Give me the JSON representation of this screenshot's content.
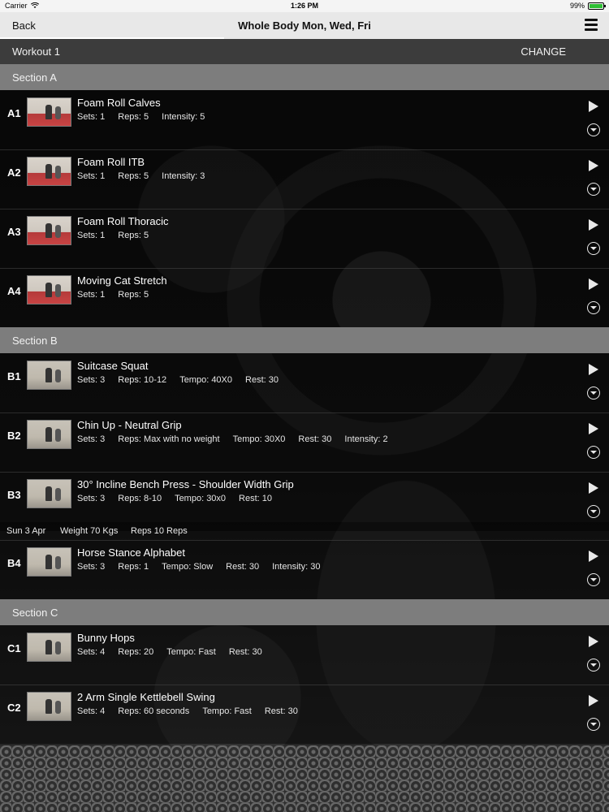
{
  "status_bar": {
    "carrier": "Carrier",
    "time": "1:26 PM",
    "battery": "99%",
    "battery_color": "#2fbf35"
  },
  "nav": {
    "back_label": "Back",
    "title": "Whole Body Mon, Wed, Fri",
    "menu_icon": "hamburger-menu-icon"
  },
  "workout": {
    "label": "Workout 1",
    "change_label": "CHANGE"
  },
  "sections": [
    {
      "title": "Section A",
      "exercises": [
        {
          "code": "A1",
          "name": "Foam Roll Calves",
          "stats": [
            "Sets: 1",
            "Reps: 5",
            "Intensity: 5"
          ]
        },
        {
          "code": "A2",
          "name": "Foam Roll ITB",
          "stats": [
            "Sets: 1",
            "Reps: 5",
            "Intensity: 3"
          ]
        },
        {
          "code": "A3",
          "name": "Foam Roll Thoracic",
          "stats": [
            "Sets: 1",
            "Reps: 5"
          ]
        },
        {
          "code": "A4",
          "name": "Moving Cat Stretch",
          "stats": [
            "Sets: 1",
            "Reps: 5"
          ]
        }
      ]
    },
    {
      "title": "Section B",
      "exercises": [
        {
          "code": "B1",
          "name": "Suitcase Squat",
          "stats": [
            "Sets: 3",
            "Reps: 10-12",
            "Tempo: 40X0",
            "Rest: 30"
          ]
        },
        {
          "code": "B2",
          "name": "Chin Up - Neutral Grip",
          "stats": [
            "Sets: 3",
            "Reps: Max with no weight",
            "Tempo: 30X0",
            "Rest: 30",
            "Intensity: 2"
          ]
        },
        {
          "code": "B3",
          "name": "30° Incline Bench Press - Shoulder Width Grip",
          "stats": [
            "Sets: 3",
            "Reps: 8-10",
            "Tempo: 30x0",
            "Rest: 10"
          ]
        },
        {
          "code": "B4",
          "name": "Horse Stance Alphabet",
          "stats": [
            "Sets: 3",
            "Reps: 1",
            "Tempo: Slow",
            "Rest: 30",
            "Intensity: 30"
          ]
        }
      ],
      "history": {
        "date": "Sun 3 Apr",
        "weight": "Weight 70 Kgs",
        "reps": "Reps 10 Reps"
      }
    },
    {
      "title": "Section C",
      "exercises": [
        {
          "code": "C1",
          "name": "Bunny Hops",
          "stats": [
            "Sets: 4",
            "Reps: 20",
            "Tempo: Fast",
            "Rest: 30"
          ]
        },
        {
          "code": "C2",
          "name": "2 Arm Single Kettlebell Swing",
          "stats": [
            "Sets: 4",
            "Reps: 60 seconds",
            "Tempo: Fast",
            "Rest: 30"
          ]
        }
      ]
    }
  ],
  "colors": {
    "section_header": "#7d7d7d",
    "workout_bar": "#3c3c3c",
    "nav_bar": "#e8e8e8"
  }
}
